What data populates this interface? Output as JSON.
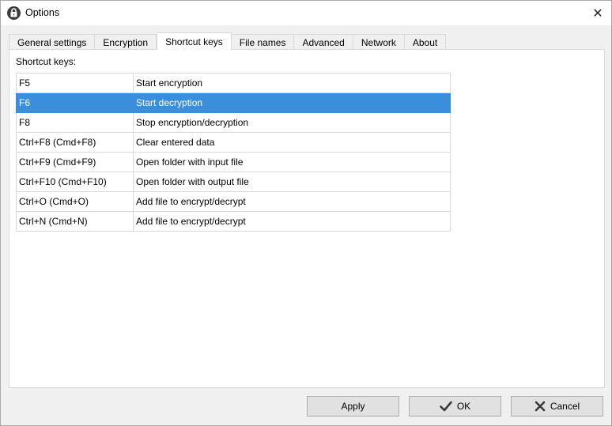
{
  "window": {
    "title": "Options",
    "close_glyph": "✕"
  },
  "tabs": [
    {
      "label": "General settings",
      "active": false
    },
    {
      "label": "Encryption",
      "active": false
    },
    {
      "label": "Shortcut keys",
      "active": true
    },
    {
      "label": "File names",
      "active": false
    },
    {
      "label": "Advanced",
      "active": false
    },
    {
      "label": "Network",
      "active": false
    },
    {
      "label": "About",
      "active": false
    }
  ],
  "panel": {
    "label": "Shortcut keys:",
    "shortcuts": [
      {
        "key": "F5",
        "action": "Start encryption"
      },
      {
        "key": "F6",
        "action": "Start decryption"
      },
      {
        "key": "F8",
        "action": "Stop encryption/decryption"
      },
      {
        "key": "Ctrl+F8 (Cmd+F8)",
        "action": "Clear entered data"
      },
      {
        "key": "Ctrl+F9 (Cmd+F9)",
        "action": "Open folder with input file"
      },
      {
        "key": "Ctrl+F10 (Cmd+F10)",
        "action": "Open folder with output file"
      },
      {
        "key": "Ctrl+O (Cmd+O)",
        "action": "Add file to encrypt/decrypt"
      },
      {
        "key": "Ctrl+N (Cmd+N)",
        "action": "Add file to encrypt/decrypt"
      }
    ],
    "selected_row": 1
  },
  "buttons": {
    "apply": "Apply",
    "ok": "OK",
    "cancel": "Cancel"
  },
  "icons": {
    "app": "lock-icon",
    "ok": "checkmark-icon",
    "cancel": "x-mark-icon"
  },
  "colors": {
    "selection": "#3a8fdd",
    "titlebar": "#ffffff",
    "dialog_bg": "#f0f0f0"
  }
}
